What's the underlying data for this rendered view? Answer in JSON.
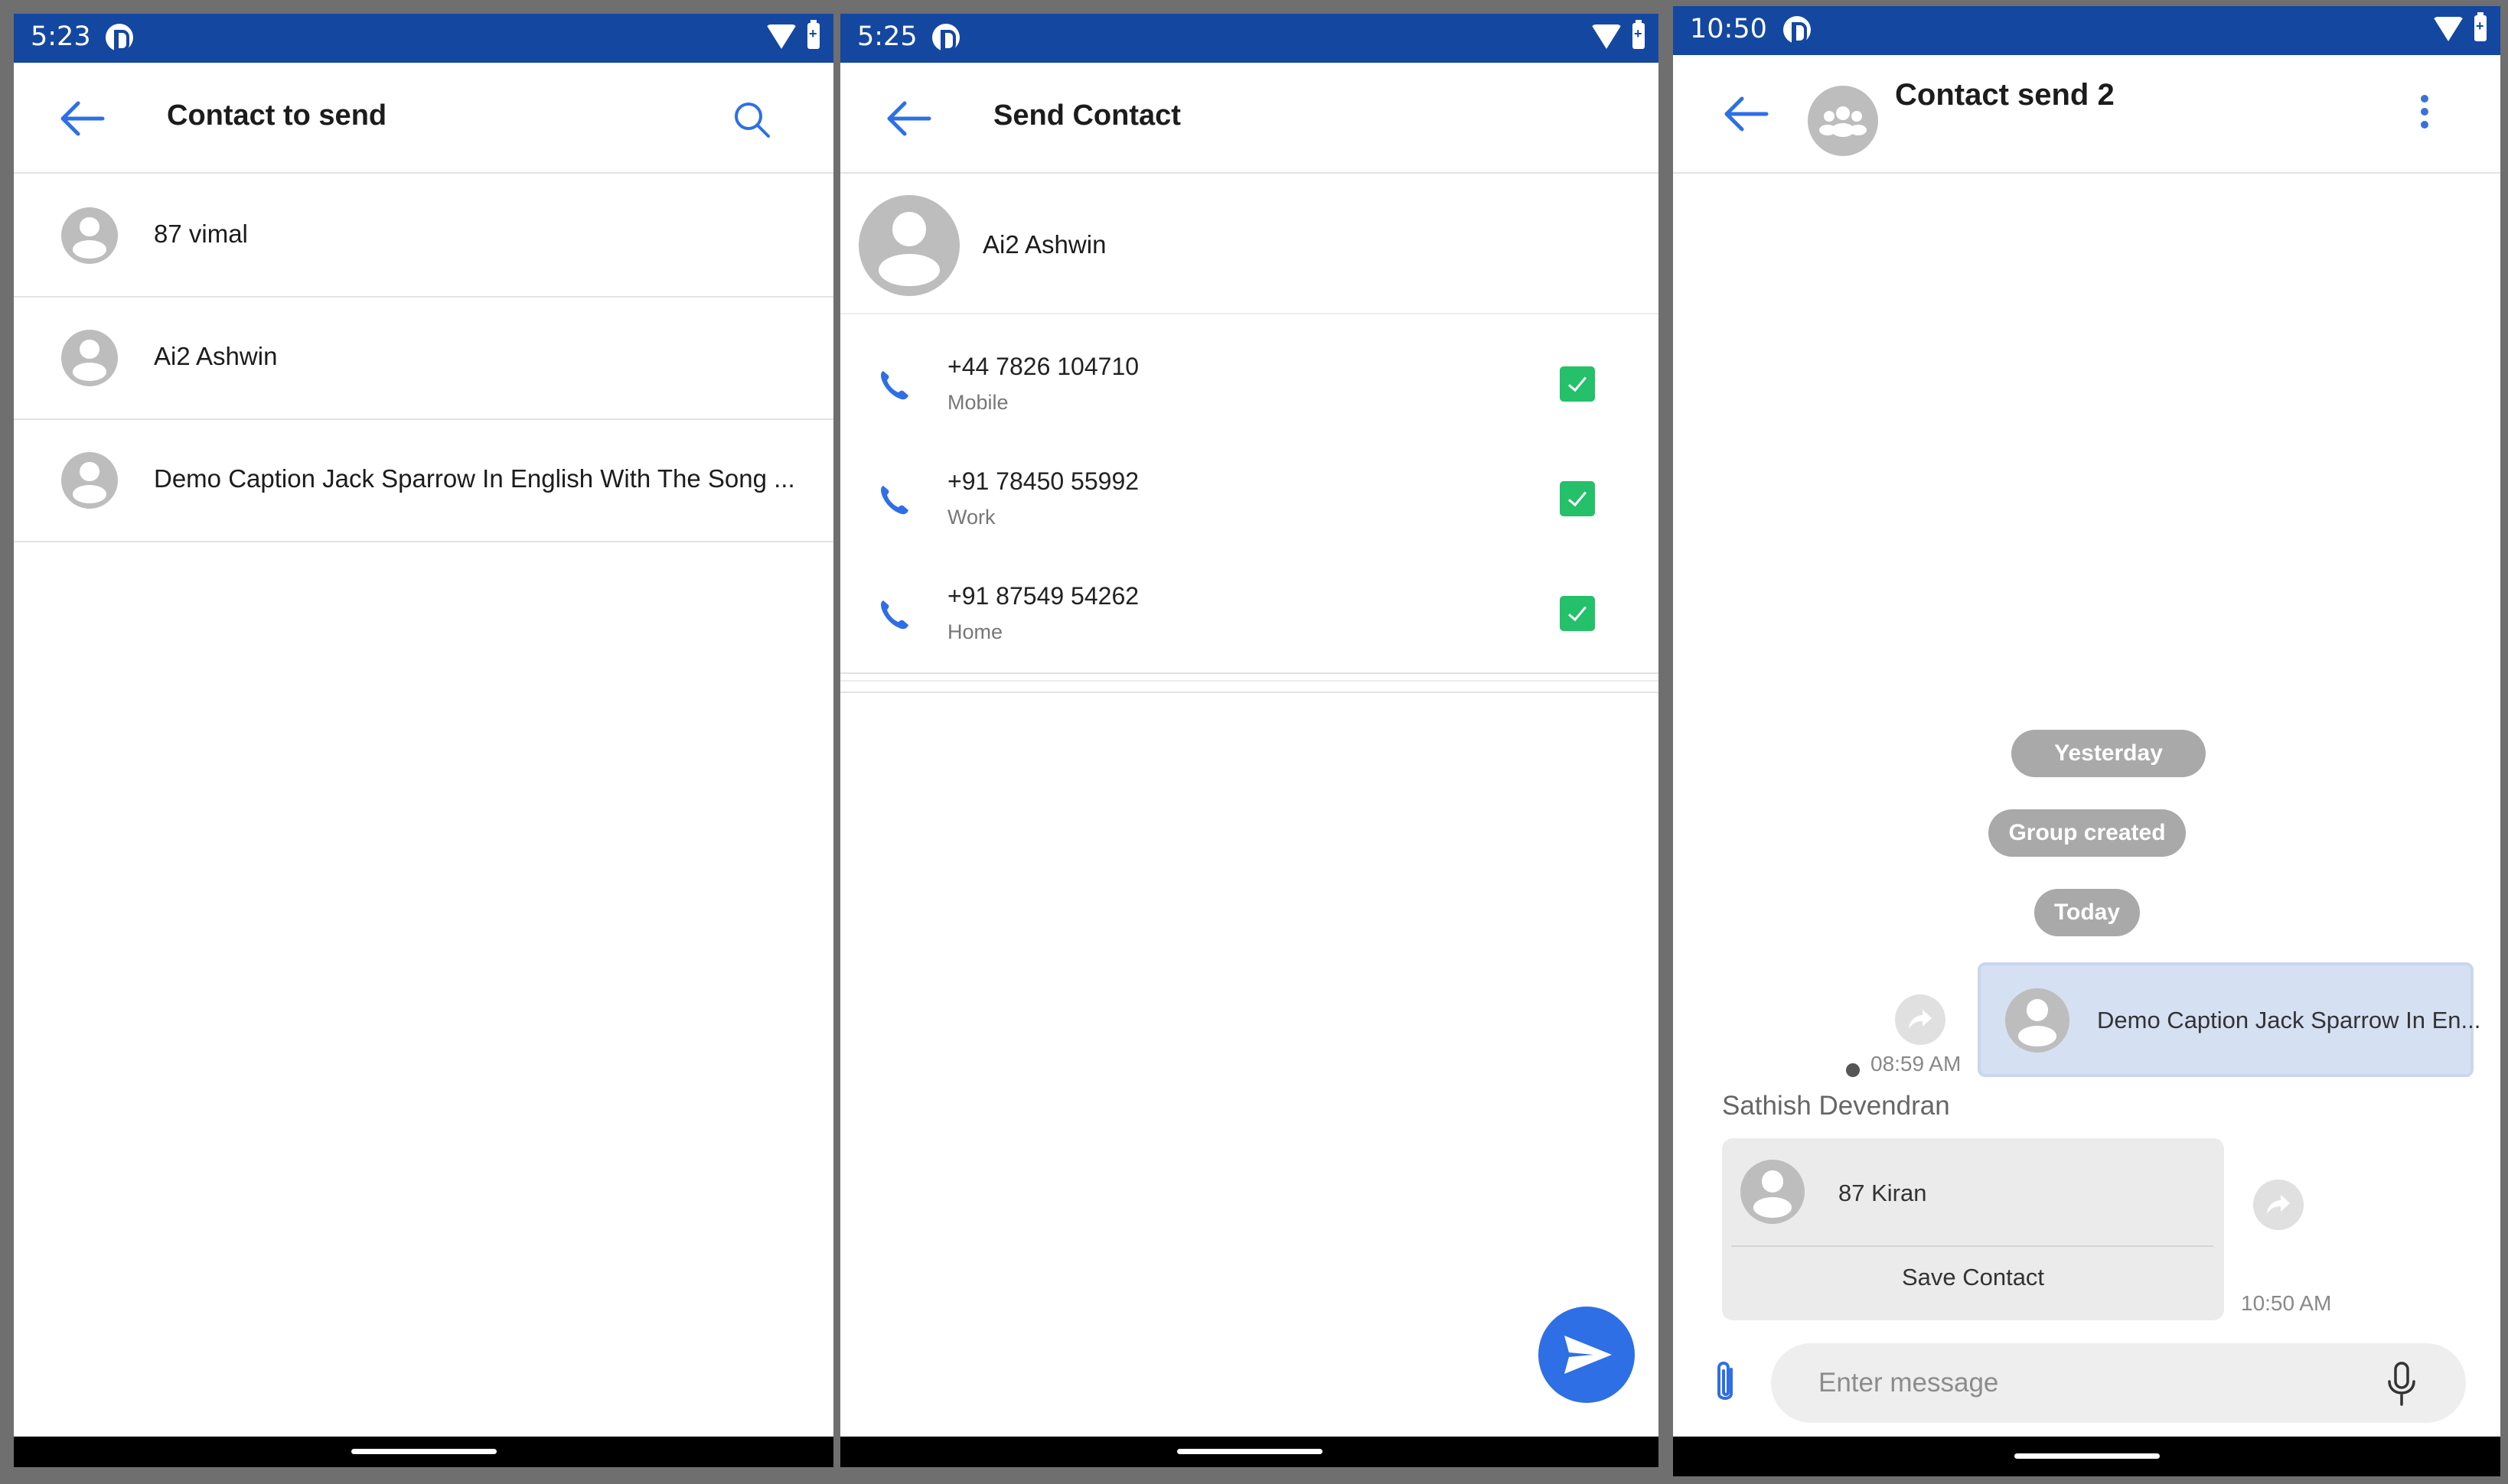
{
  "panel1": {
    "status_time": "5:23",
    "title": "Contact to send",
    "contacts": [
      {
        "name": "87 vimal"
      },
      {
        "name": "Ai2 Ashwin"
      },
      {
        "name": "Demo Caption Jack Sparrow In English With The Song ..."
      }
    ]
  },
  "panel2": {
    "status_time": "5:25",
    "title": "Send Contact",
    "contact_name": "Ai2 Ashwin",
    "numbers": [
      {
        "value": "+44 7826 104710",
        "type": "Mobile",
        "checked": true
      },
      {
        "value": "+91 78450 55992",
        "type": "Work",
        "checked": true
      },
      {
        "value": "+91 87549 54262",
        "type": "Home",
        "checked": true
      }
    ]
  },
  "panel3": {
    "status_time": "10:50",
    "title": "Contact send 2",
    "badges": [
      "Yesterday",
      "Group created",
      "Today"
    ],
    "outgoing": {
      "contact_name": "Demo Caption Jack Sparrow In En...",
      "time": "08:59 AM"
    },
    "incoming": {
      "sender": "Sathish Devendran",
      "contact_name": "87 Kiran",
      "action": "Save Contact",
      "time": "10:50 AM"
    },
    "compose_placeholder": "Enter message"
  },
  "colors": {
    "status_bar": "#1447a0",
    "accent": "#2f6fe5",
    "checkbox": "#24c06a",
    "outgoing_bubble": "#d6e0f3"
  },
  "icons": [
    "back-arrow-icon",
    "search-icon",
    "phone-icon",
    "checkbox-checked-icon",
    "send-icon",
    "group-avatar-icon",
    "more-vert-icon",
    "forward-icon",
    "attach-icon",
    "mic-icon",
    "wifi-icon",
    "battery-icon"
  ]
}
